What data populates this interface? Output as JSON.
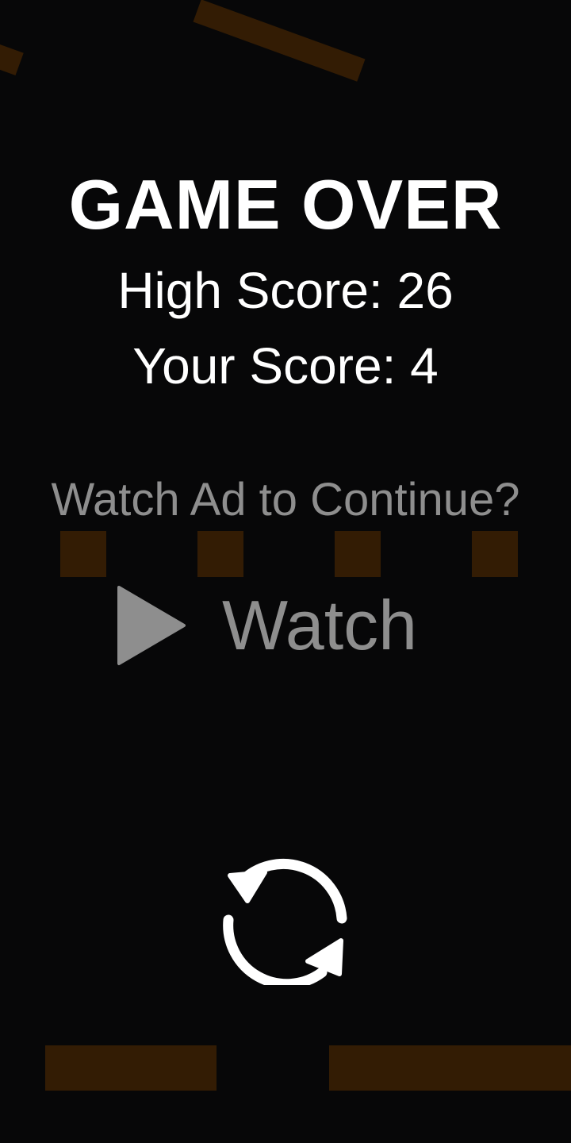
{
  "game_over": {
    "title": "GAME OVER",
    "high_score_text": "High Score: 26",
    "your_score_text": "Your Score: 4"
  },
  "continue": {
    "prompt": "Watch Ad to Continue?",
    "button_label": "Watch",
    "button_icon": "play-icon"
  },
  "restart": {
    "icon": "restart-icon"
  },
  "colors": {
    "background": "#070708",
    "block": "#331c04",
    "primary_text": "#ffffff",
    "muted_text": "#8e8e8e"
  }
}
